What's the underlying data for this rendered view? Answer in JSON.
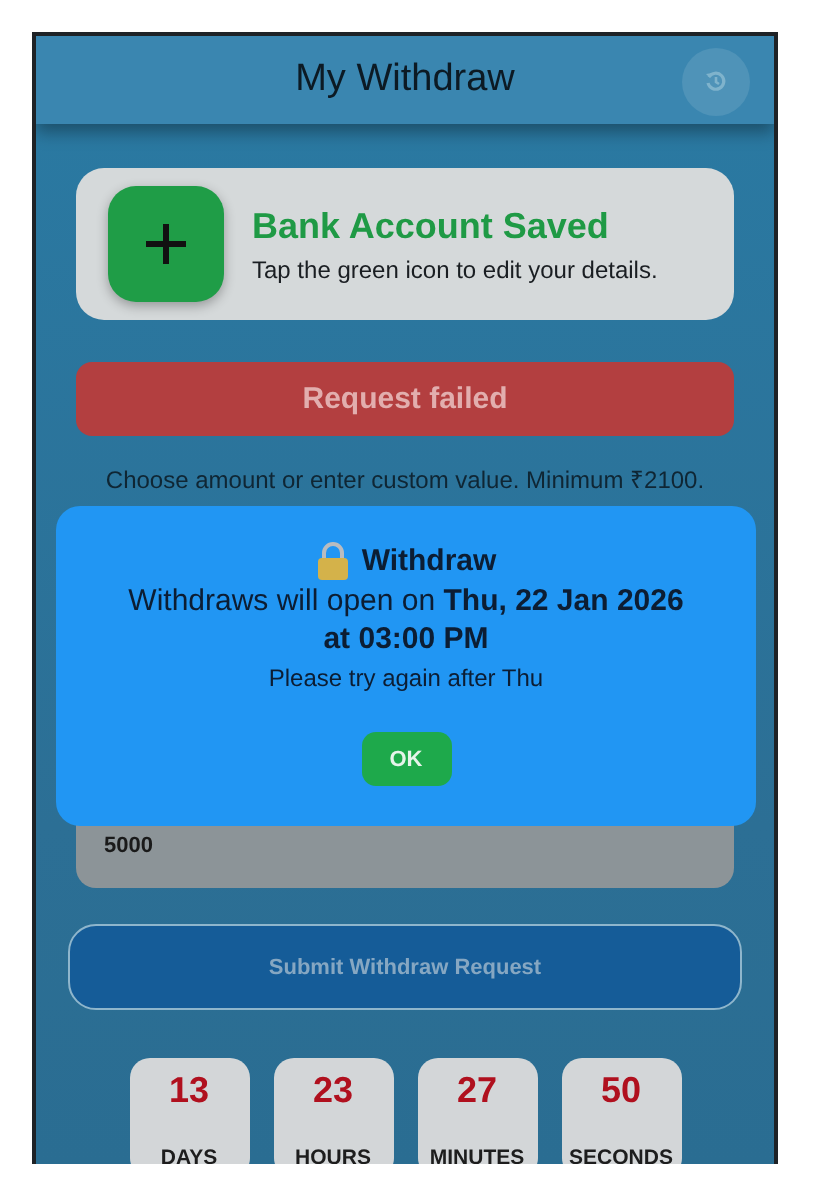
{
  "header": {
    "title": "My Withdraw"
  },
  "bank_card": {
    "title": "Bank Account Saved",
    "subtitle": "Tap the green icon to edit your details."
  },
  "error_banner": "Request failed",
  "hint": "Choose amount or enter custom value. Minimum ₹2100.",
  "amount_field": {
    "value": "5000"
  },
  "submit_button": "Submit Withdraw Request",
  "countdown": [
    {
      "value": "13",
      "unit": "DAYS"
    },
    {
      "value": "23",
      "unit": "HOURS"
    },
    {
      "value": "27",
      "unit": "MINUTES"
    },
    {
      "value": "50",
      "unit": "SECONDS"
    }
  ],
  "dialog": {
    "title": "Withdraw",
    "message": "Withdraws will open on **Thu, 22 Jan 2026 at 03:00 PM**",
    "note": "Please try again after Thu",
    "button": "OK"
  }
}
